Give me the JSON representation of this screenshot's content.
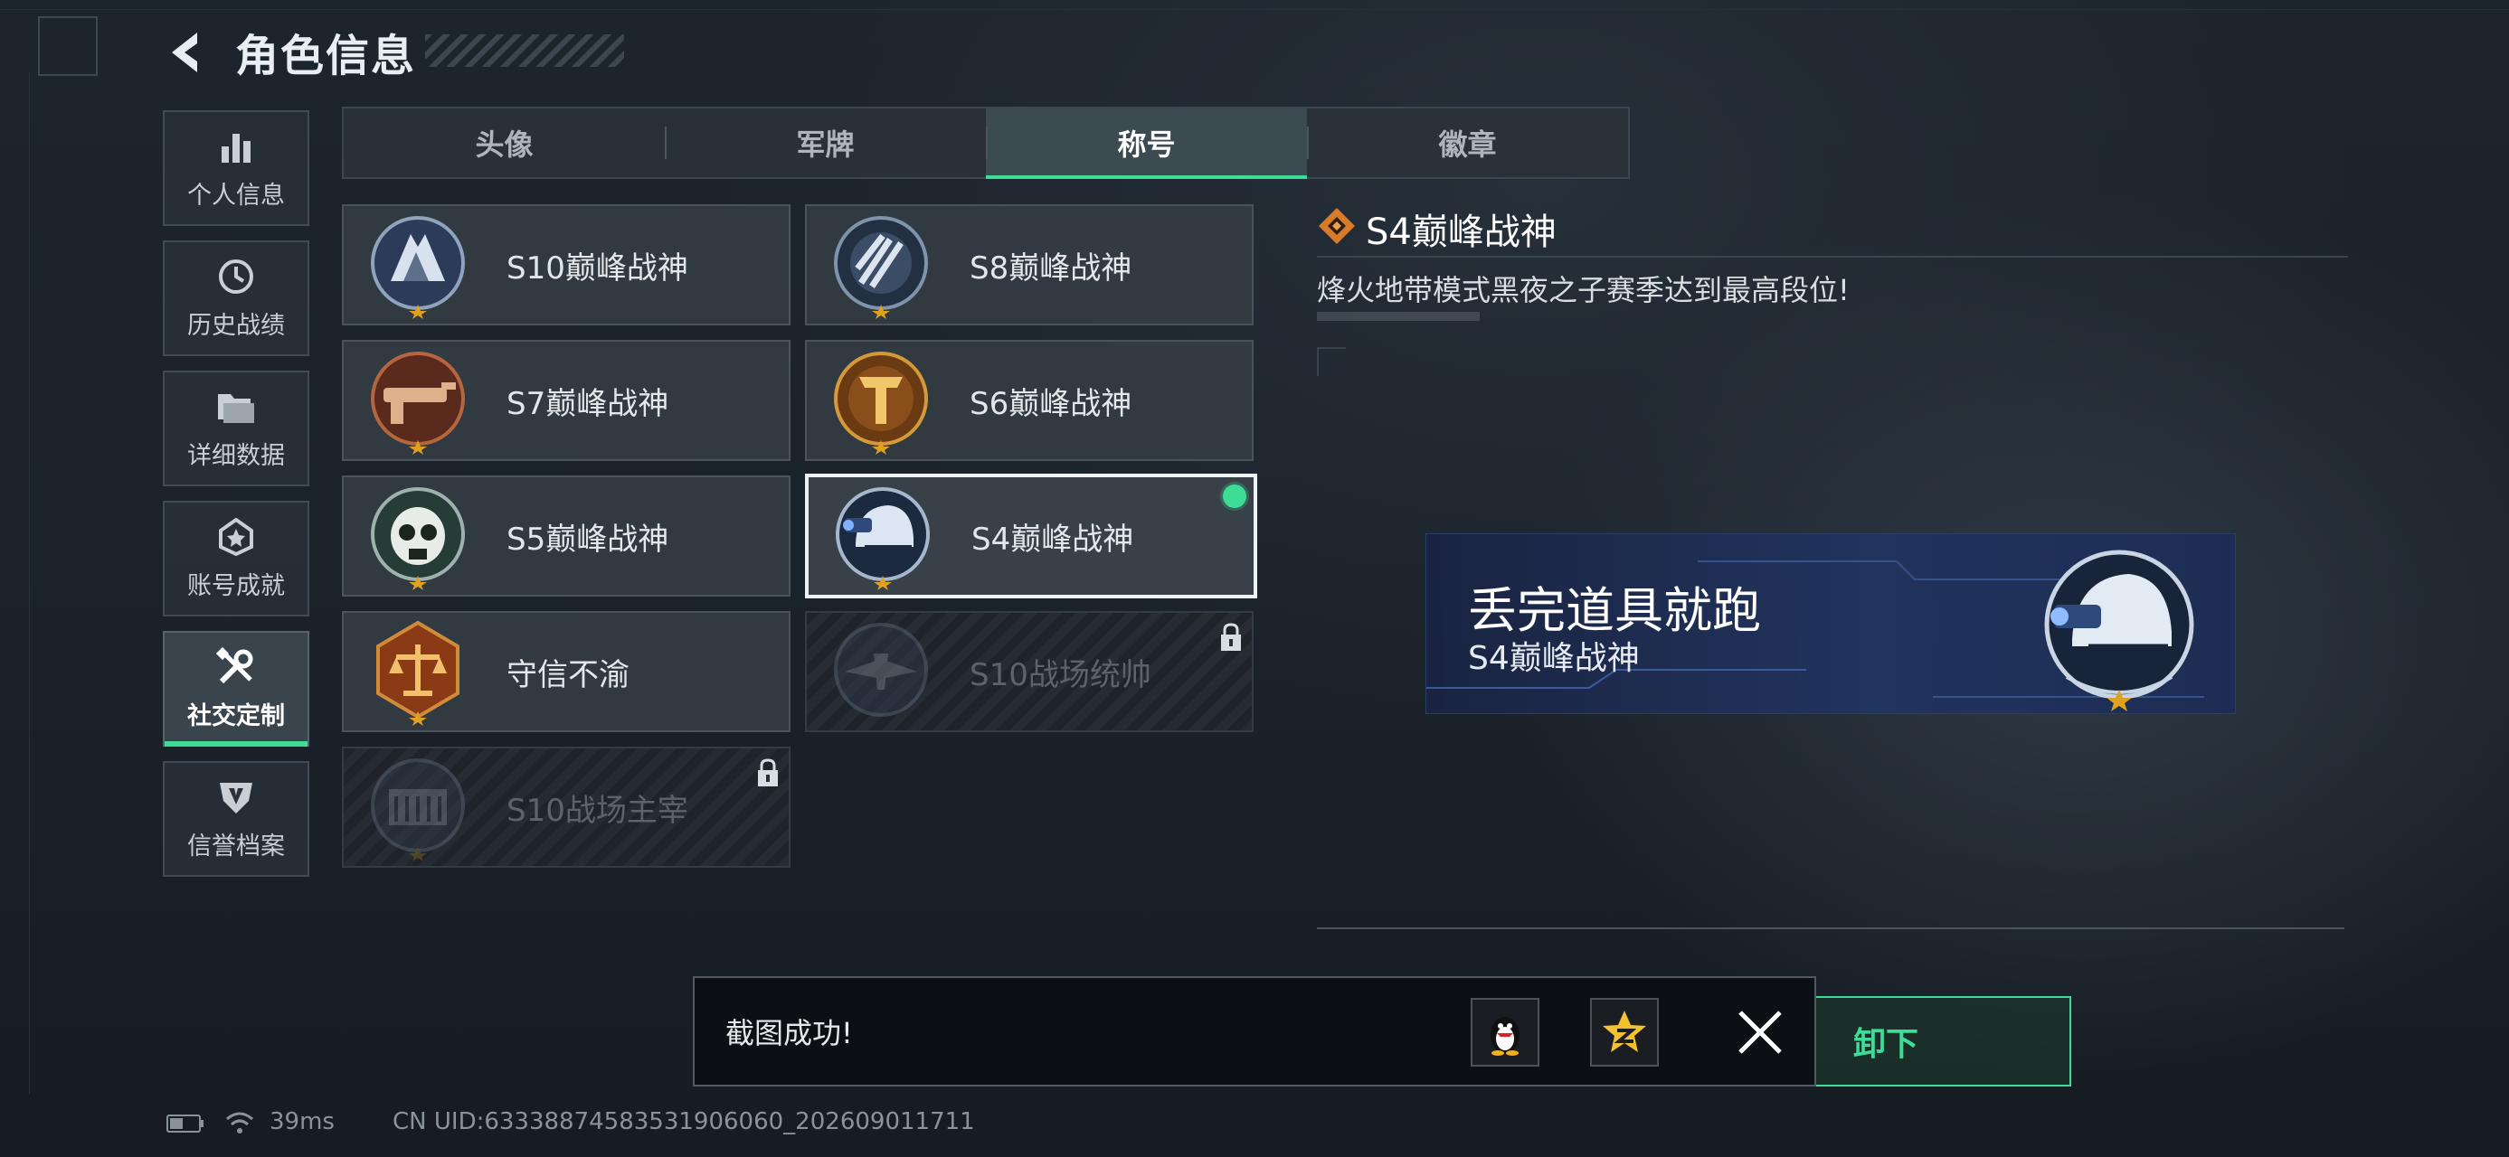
{
  "header": {
    "title": "角色信息"
  },
  "nav": {
    "items": [
      {
        "label": "个人信息",
        "icon": "bar-chart-icon"
      },
      {
        "label": "历史战绩",
        "icon": "clock-history-icon"
      },
      {
        "label": "详细数据",
        "icon": "folder-icon"
      },
      {
        "label": "账号成就",
        "icon": "achievement-icon"
      },
      {
        "label": "社交定制",
        "icon": "wrench-tools-icon",
        "active": true
      },
      {
        "label": "信誉档案",
        "icon": "credit-shield-icon"
      }
    ]
  },
  "tabs": [
    {
      "label": "头像"
    },
    {
      "label": "军牌"
    },
    {
      "label": "称号",
      "active": true
    },
    {
      "label": "徽章"
    }
  ],
  "titles": [
    {
      "name": "S10巅峰战神",
      "state": "unlocked"
    },
    {
      "name": "S8巅峰战神",
      "state": "unlocked"
    },
    {
      "name": "S7巅峰战神",
      "state": "unlocked"
    },
    {
      "name": "S6巅峰战神",
      "state": "unlocked"
    },
    {
      "name": "S5巅峰战神",
      "state": "unlocked"
    },
    {
      "name": "S4巅峰战神",
      "state": "selected-equipped"
    },
    {
      "name": "守信不渝",
      "state": "unlocked"
    },
    {
      "name": "S10战场统帅",
      "state": "locked"
    },
    {
      "name": "S10战场主宰",
      "state": "locked"
    }
  ],
  "detail": {
    "title": "S4巅峰战神",
    "description": "烽火地带模式黑夜之子赛季达到最高段位!"
  },
  "preview": {
    "player_name": "丢完道具就跑",
    "title": "S4巅峰战神"
  },
  "unequip_button": {
    "label": "卸下"
  },
  "toast": {
    "message": "截图成功!",
    "share_targets": [
      "qq-penguin-icon",
      "qzone-star-icon"
    ]
  },
  "status": {
    "ping": "39ms",
    "uid": "CN UID:6333887458353190606​0_202609011711"
  },
  "colors": {
    "accent_green": "#3ddc97",
    "emblem_gold": "#e0a020",
    "preview_bg": "#1f3260"
  }
}
